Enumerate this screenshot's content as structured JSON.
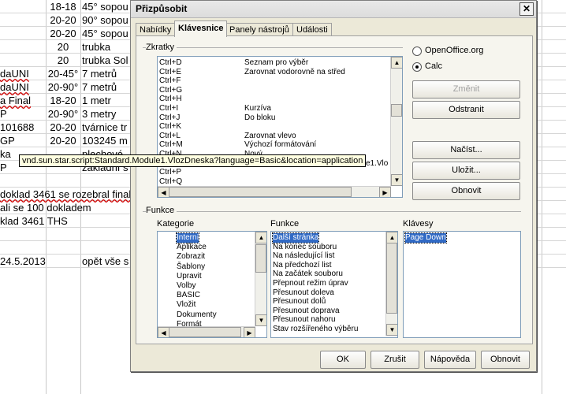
{
  "sheet": {
    "rows": [
      {
        "a": "",
        "b": "18-18",
        "c": "45° sopou"
      },
      {
        "a": "",
        "b": "20-20",
        "c": "90° sopou"
      },
      {
        "a": "",
        "b": "20-20",
        "c": "45° sopou"
      },
      {
        "a": "",
        "b": "20",
        "c": "trubka"
      },
      {
        "a": "",
        "b": "20",
        "c": "trubka Sol"
      },
      {
        "a": "daUNI",
        "b": "20-45°",
        "c": "7 metrů"
      },
      {
        "a": "daUNI",
        "b": "20-90°",
        "c": "7 metrů"
      },
      {
        "a": "a Final",
        "b": "18-20",
        "c": "1 metr"
      },
      {
        "a": "P",
        "b": "20-90°",
        "c": "3 metry"
      },
      {
        "a": "101688",
        "b": "20-20",
        "c": "tvárnice tr"
      },
      {
        "a": "GP",
        "b": "20-20",
        "c": "103245 m"
      },
      {
        "a": "ka",
        "b": "",
        "c": "plechové"
      },
      {
        "a": "P",
        "b": "",
        "c": "základní s"
      },
      {
        "a": "",
        "b": "",
        "c": ""
      },
      {
        "a": "doklad 3461 se rozebral final",
        "b": "",
        "c": ""
      },
      {
        "a": "ali se 100 dokladem",
        "b": "",
        "c": ""
      },
      {
        "a": "klad 3461 THS",
        "b": "",
        "c": ""
      },
      {
        "a": "",
        "b": "",
        "c": ""
      },
      {
        "a": "",
        "b": "",
        "c": ""
      },
      {
        "a": "24.5.2013",
        "b": "",
        "c": "opět vše s"
      }
    ]
  },
  "dialog": {
    "title": "Přizpůsobit",
    "close_glyph": "✕",
    "tabs": [
      "Nabídky",
      "Klávesnice",
      "Panely nástrojů",
      "Události"
    ],
    "shortcuts_label": "Zkratky",
    "shortcuts": [
      {
        "key": "Ctrl+D",
        "cmd": "Seznam pro výběr"
      },
      {
        "key": "Ctrl+E",
        "cmd": "Zarovnat vodorovně na střed"
      },
      {
        "key": "Ctrl+F",
        "cmd": ""
      },
      {
        "key": "Ctrl+G",
        "cmd": ""
      },
      {
        "key": "Ctrl+H",
        "cmd": ""
      },
      {
        "key": "Ctrl+I",
        "cmd": "Kurzíva"
      },
      {
        "key": "Ctrl+J",
        "cmd": "Do bloku"
      },
      {
        "key": "Ctrl+K",
        "cmd": ""
      },
      {
        "key": "Ctrl+L",
        "cmd": "Zarovnat vlevo"
      },
      {
        "key": "Ctrl+M",
        "cmd": "Výchozí formátování"
      },
      {
        "key": "Ctrl+N",
        "cmd": "Nový"
      },
      {
        "key": "Ctrl+O",
        "cmd": "vnd.sun.star.script:Standard.Module1.Vlo"
      },
      {
        "key": "Ctrl+P",
        "cmd": ""
      },
      {
        "key": "Ctrl+Q",
        "cmd": ""
      }
    ],
    "radio_openoffice": "OpenOffice.org",
    "radio_calc": "Calc",
    "btn_change": "Změnit",
    "btn_remove": "Odstranit",
    "btn_load": "Načíst...",
    "btn_save": "Uložit...",
    "btn_reset": "Obnovit",
    "tooltip": "vnd.sun.star.script:Standard.Module1.VlozDneska?language=Basic&location=application",
    "functions_label": "Funkce",
    "category_label": "Kategorie",
    "function_label": "Funkce",
    "keys_label": "Klávesy",
    "categories": [
      "Interní",
      "Aplikace",
      "Zobrazit",
      "Šablony",
      "Upravit",
      "Volby",
      "BASIC",
      "Vložit",
      "Dokumenty",
      "Formát"
    ],
    "functions": [
      "Další stránka",
      "Na konec souboru",
      "Na následující list",
      "Na předchozí list",
      "Na začátek souboru",
      "Přepnout režim úprav",
      "Přesunout doleva",
      "Přesunout dolů",
      "Přesunout doprava",
      "Přesunout nahoru",
      "Stav rozšířeného výběru"
    ],
    "keys": [
      "Page Down"
    ],
    "btn_ok": "OK",
    "btn_cancel": "Zrušit",
    "btn_help": "Nápověda",
    "btn_reset_bottom": "Obnovit"
  }
}
